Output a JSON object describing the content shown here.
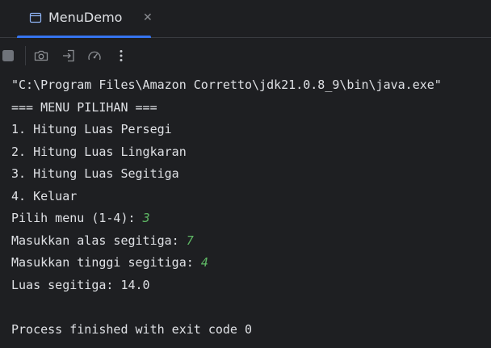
{
  "tab": {
    "title": "MenuDemo",
    "icon": "console-window-icon",
    "close_glyph": "✕"
  },
  "toolbar": {
    "buttons": [
      {
        "name": "stop-icon"
      },
      {
        "name": "camera-icon"
      },
      {
        "name": "exit-icon"
      },
      {
        "name": "speed-gauge-icon"
      },
      {
        "name": "more-vertical-icon"
      }
    ]
  },
  "console": {
    "lines": [
      {
        "text": "\"C:\\Program Files\\Amazon Corretto\\jdk21.0.8_9\\bin\\java.exe\""
      },
      {
        "text": "=== MENU PILIHAN ==="
      },
      {
        "text": "1. Hitung Luas Persegi"
      },
      {
        "text": "2. Hitung Luas Lingkaran"
      },
      {
        "text": "3. Hitung Luas Segitiga"
      },
      {
        "text": "4. Keluar"
      },
      {
        "prompt": "Pilih menu (1-4): ",
        "input": "3"
      },
      {
        "prompt": "Masukkan alas segitiga: ",
        "input": "7"
      },
      {
        "prompt": "Masukkan tinggi segitiga: ",
        "input": "4"
      },
      {
        "text": "Luas segitiga: 14.0"
      },
      {
        "text": ""
      },
      {
        "text": "Process finished with exit code 0"
      }
    ]
  },
  "colors": {
    "background": "#1e1f22",
    "text": "#dfe1e5",
    "user_input": "#5fb865",
    "tab_accent": "#3574f0"
  }
}
